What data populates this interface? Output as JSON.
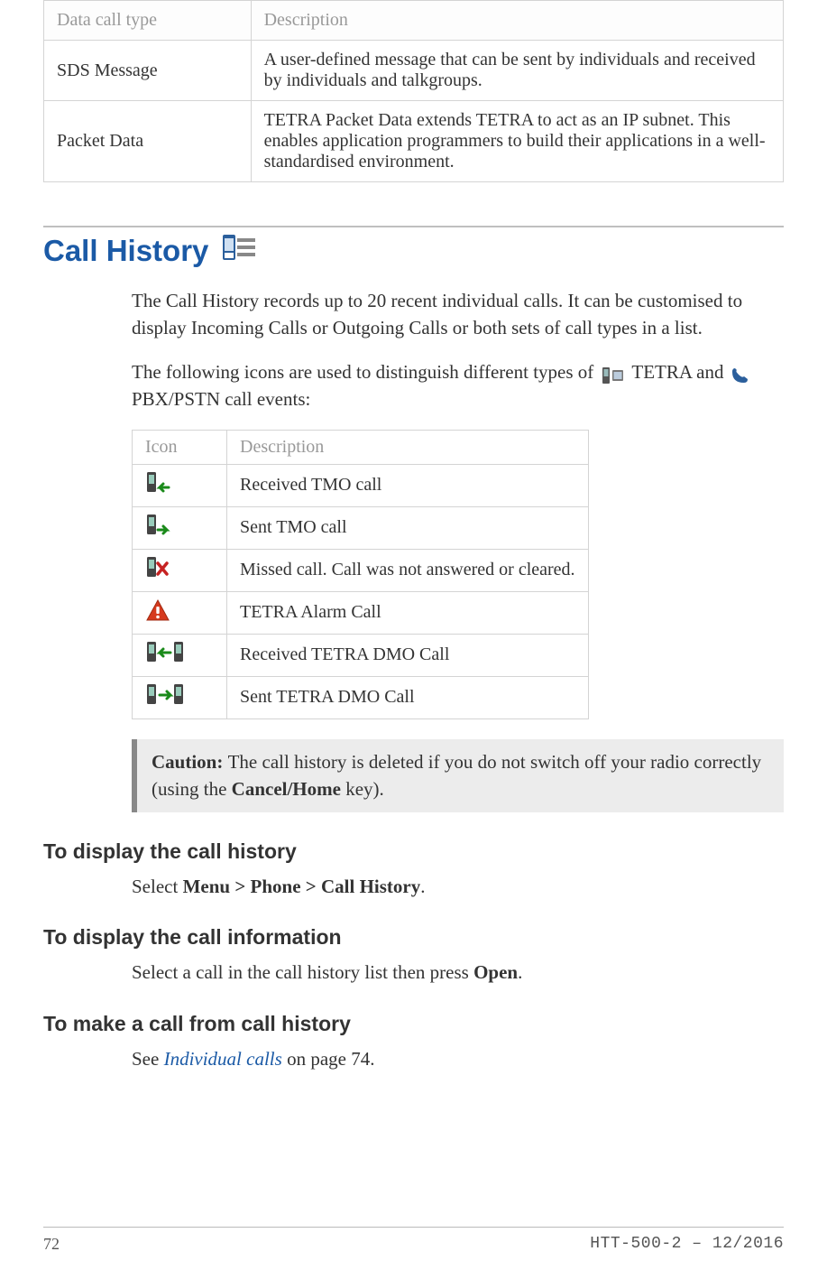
{
  "table1": {
    "headers": [
      "Data call type",
      "Description"
    ],
    "rows": [
      {
        "type": "SDS Message",
        "desc": "A user-defined message that can be sent by individuals and received by individuals and talkgroups."
      },
      {
        "type": "Packet Data",
        "desc": "TETRA Packet Data extends TETRA to act as an IP subnet. This enables application programmers to build their applications in a well-standardised environment."
      }
    ]
  },
  "section": {
    "title": "Call History",
    "icon_name": "call-history-icon",
    "intro1": "The Call History records up to 20 recent individual calls. It can be customised to display Incoming Calls or Outgoing Calls or both sets of call types in a list.",
    "intro2_pre": "The following icons are used to distinguish different types of",
    "intro2_mid": "TETRA and",
    "intro2_post": "PBX/PSTN call events:"
  },
  "table2": {
    "headers": [
      "Icon",
      "Description"
    ],
    "rows": [
      {
        "icon_name": "received-tmo-call-icon",
        "desc": "Received TMO call"
      },
      {
        "icon_name": "sent-tmo-call-icon",
        "desc": "Sent TMO call"
      },
      {
        "icon_name": "missed-call-icon",
        "desc": "Missed call. Call was not answered or cleared."
      },
      {
        "icon_name": "tetra-alarm-call-icon",
        "desc": "TETRA Alarm Call"
      },
      {
        "icon_name": "received-tetra-dmo-call-icon",
        "desc": "Received TETRA DMO Call"
      },
      {
        "icon_name": "sent-tetra-dmo-call-icon",
        "desc": "Sent TETRA DMO Call"
      }
    ]
  },
  "caution": {
    "label": "Caution:",
    "text_pre": "The call history is deleted if you do not switch off your radio correctly (using the ",
    "text_bold": "Cancel/Home",
    "text_post": " key)."
  },
  "subsections": [
    {
      "heading": "To display the call history",
      "body_pre": "Select ",
      "body_bold": "Menu > Phone > Call History",
      "body_post": "."
    },
    {
      "heading": "To display the call information",
      "body_pre": "Select a call in the call history list then press ",
      "body_bold": "Open",
      "body_post": "."
    },
    {
      "heading": "To make a call from call history",
      "body_pre": "See  ",
      "body_link": "Individual calls",
      "body_post": " on page 74."
    }
  ],
  "footer": {
    "page": "72",
    "doc_id": "HTT-500-2 – 12/2016"
  }
}
